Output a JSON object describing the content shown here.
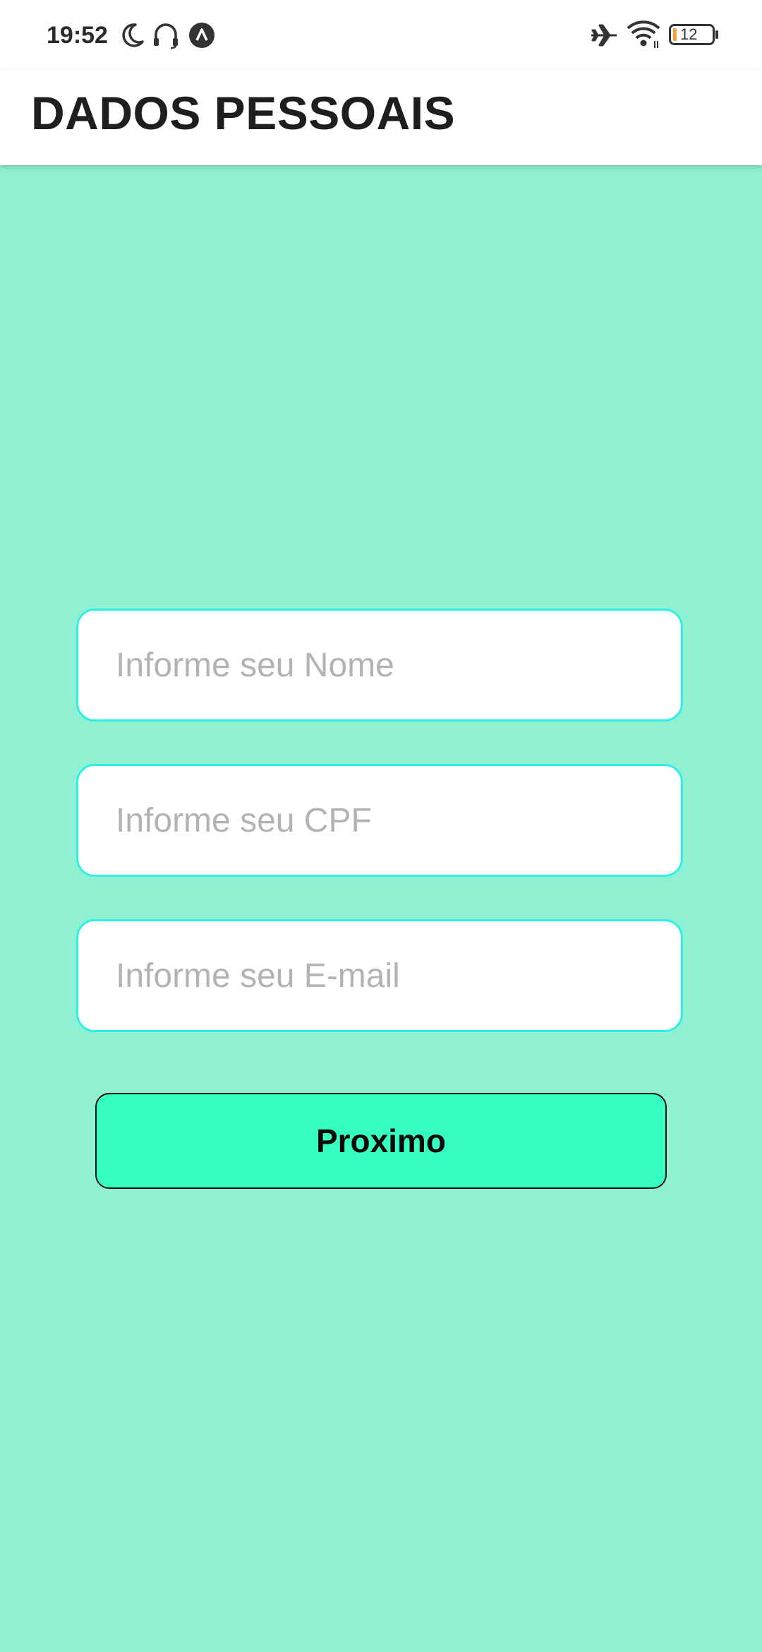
{
  "status_bar": {
    "time": "19:52",
    "battery_level": "12",
    "icons": [
      "moon-icon",
      "headphones-icon",
      "notification-app-icon",
      "airplane-icon",
      "wifi-icon",
      "battery-icon"
    ]
  },
  "app_bar": {
    "title": "DADOS PESSOAIS"
  },
  "form": {
    "name_placeholder": "Informe seu Nome",
    "cpf_placeholder": "Informe seu CPF",
    "email_placeholder": "Informe seu E-mail",
    "next_label": "Proximo"
  },
  "colors": {
    "background": "#8FF1D2",
    "field_border": "#2EF0E8",
    "button": "#36FFC0"
  }
}
